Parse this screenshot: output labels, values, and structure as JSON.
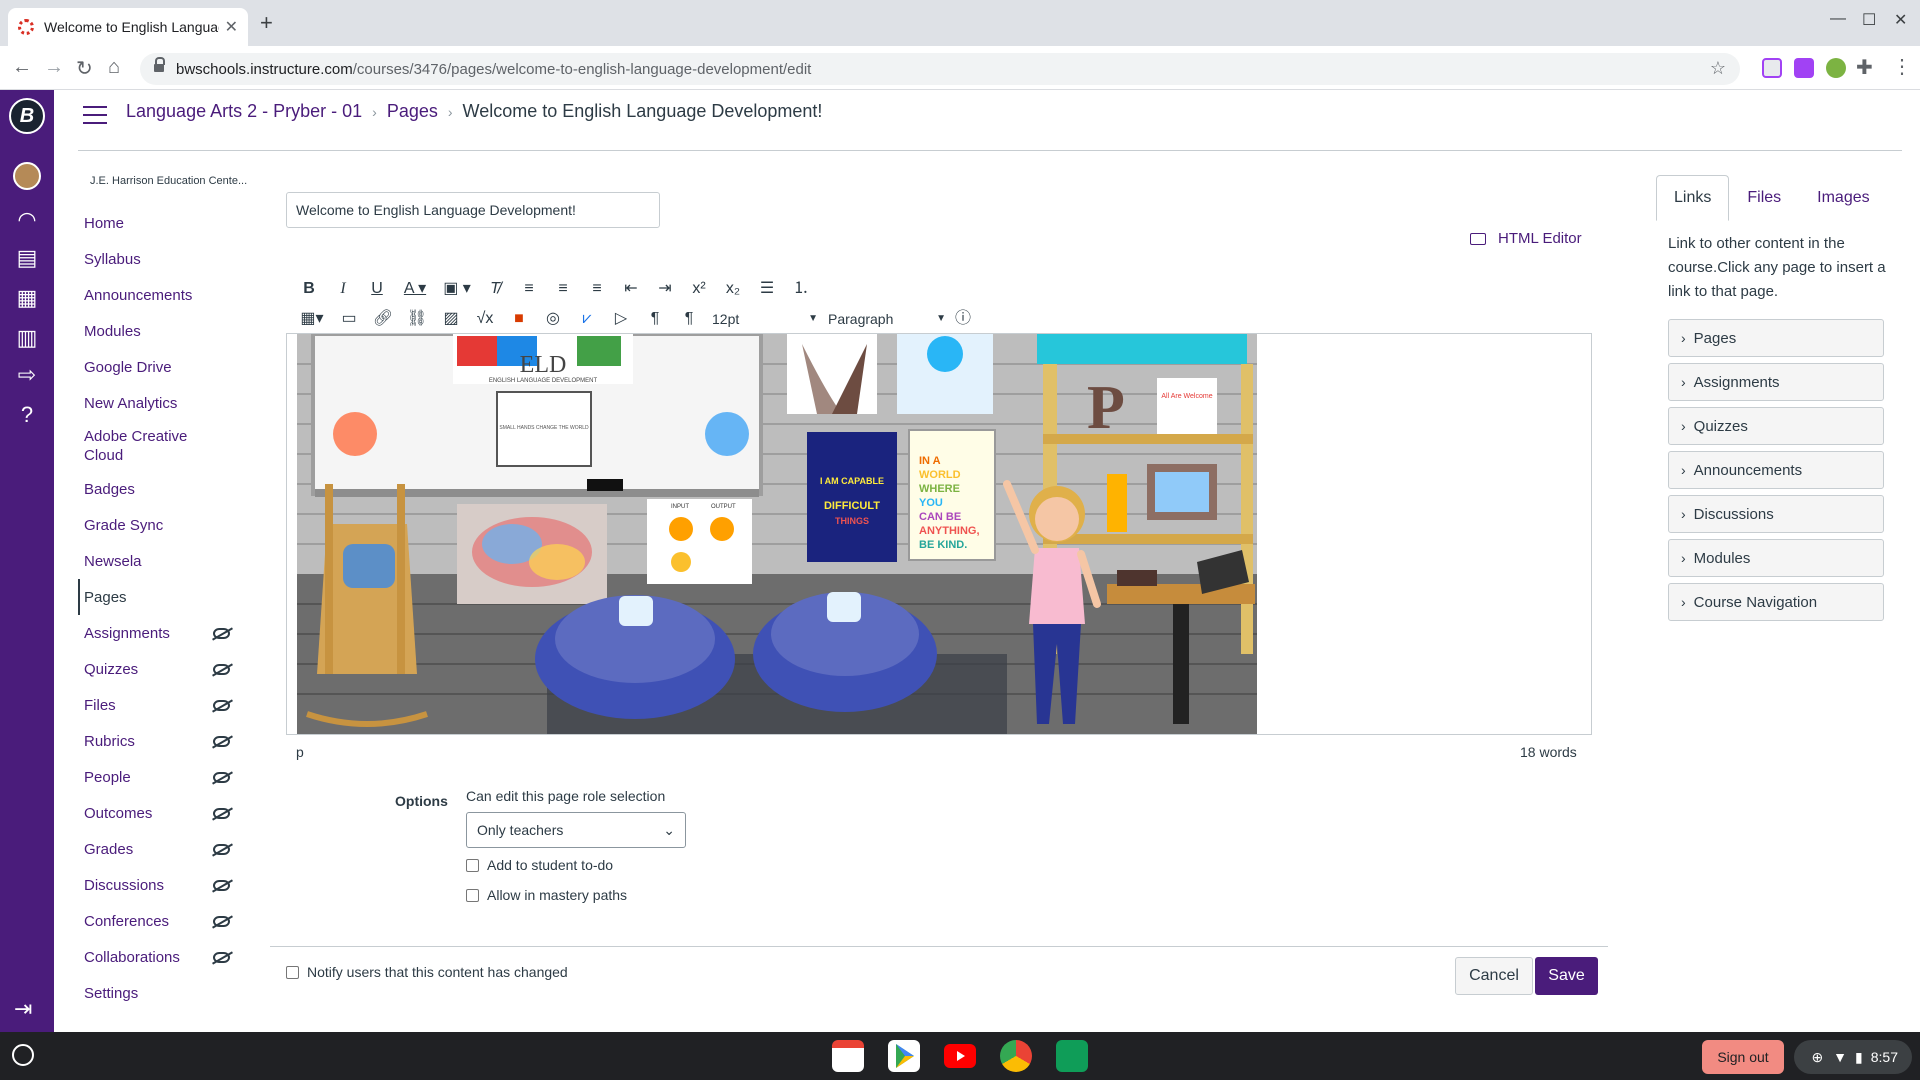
{
  "browser": {
    "tab_title": "Welcome to English Language D",
    "url_domain": "bwschools.instructure.com",
    "url_path": "/courses/3476/pages/welcome-to-english-language-development/edit"
  },
  "breadcrumb": {
    "course": "Language Arts 2 - Pryber - 01",
    "section": "Pages",
    "page": "Welcome to English Language Development!"
  },
  "course_subtitle": "J.E. Harrison Education Cente...",
  "course_nav": [
    {
      "label": "Home",
      "hidden": false
    },
    {
      "label": "Syllabus",
      "hidden": false
    },
    {
      "label": "Announcements",
      "hidden": false
    },
    {
      "label": "Modules",
      "hidden": false
    },
    {
      "label": "Google Drive",
      "hidden": false
    },
    {
      "label": "New Analytics",
      "hidden": false
    },
    {
      "label": "Adobe Creative Cloud",
      "hidden": false
    },
    {
      "label": "Badges",
      "hidden": false
    },
    {
      "label": "Grade Sync",
      "hidden": false
    },
    {
      "label": "Newsela",
      "hidden": false
    },
    {
      "label": "Pages",
      "hidden": false,
      "active": true
    },
    {
      "label": "Assignments",
      "hidden": true
    },
    {
      "label": "Quizzes",
      "hidden": true
    },
    {
      "label": "Files",
      "hidden": true
    },
    {
      "label": "Rubrics",
      "hidden": true
    },
    {
      "label": "People",
      "hidden": true
    },
    {
      "label": "Outcomes",
      "hidden": true
    },
    {
      "label": "Grades",
      "hidden": true
    },
    {
      "label": "Discussions",
      "hidden": true
    },
    {
      "label": "Conferences",
      "hidden": true
    },
    {
      "label": "Collaborations",
      "hidden": true
    },
    {
      "label": "Settings",
      "hidden": false
    }
  ],
  "editor": {
    "title_value": "Welcome to English Language Development!",
    "html_editor_label": "HTML Editor",
    "font_size": "12pt",
    "block_format": "Paragraph",
    "status_path": "p",
    "word_count": "18 words",
    "image": {
      "eld_title": "ELD",
      "eld_subtitle": "ENGLISH LANGUAGE DEVELOPMENT",
      "banner_text": "SMALL HANDS CHANGE THE WORLD",
      "poster_capable": "I AM CAPABLE OF DOING DIFFICULT THINGS",
      "poster_kind": "IN A WORLD WHERE YOU CAN BE ANYTHING, BE KIND.",
      "letter": "P",
      "welcome_sign": "All Are Welcome",
      "chart_input": "INPUT",
      "chart_output": "OUTPUT"
    }
  },
  "options": {
    "label": "Options",
    "role_label": "Can edit this page role selection",
    "role_value": "Only teachers",
    "todo_label": "Add to student to-do",
    "mastery_label": "Allow in mastery paths"
  },
  "footer": {
    "notify_label": "Notify users that this content has changed",
    "cancel": "Cancel",
    "save": "Save"
  },
  "sidebar": {
    "tabs": [
      "Links",
      "Files",
      "Images"
    ],
    "description": "Link to other content in the course.Click any page to insert a link to that page.",
    "items": [
      "Pages",
      "Assignments",
      "Quizzes",
      "Announcements",
      "Discussions",
      "Modules",
      "Course Navigation"
    ]
  },
  "shelf": {
    "signout": "Sign out",
    "time": "8:57"
  },
  "colors": {
    "brand": "#4a1c7b",
    "text": "#2d3b45"
  }
}
